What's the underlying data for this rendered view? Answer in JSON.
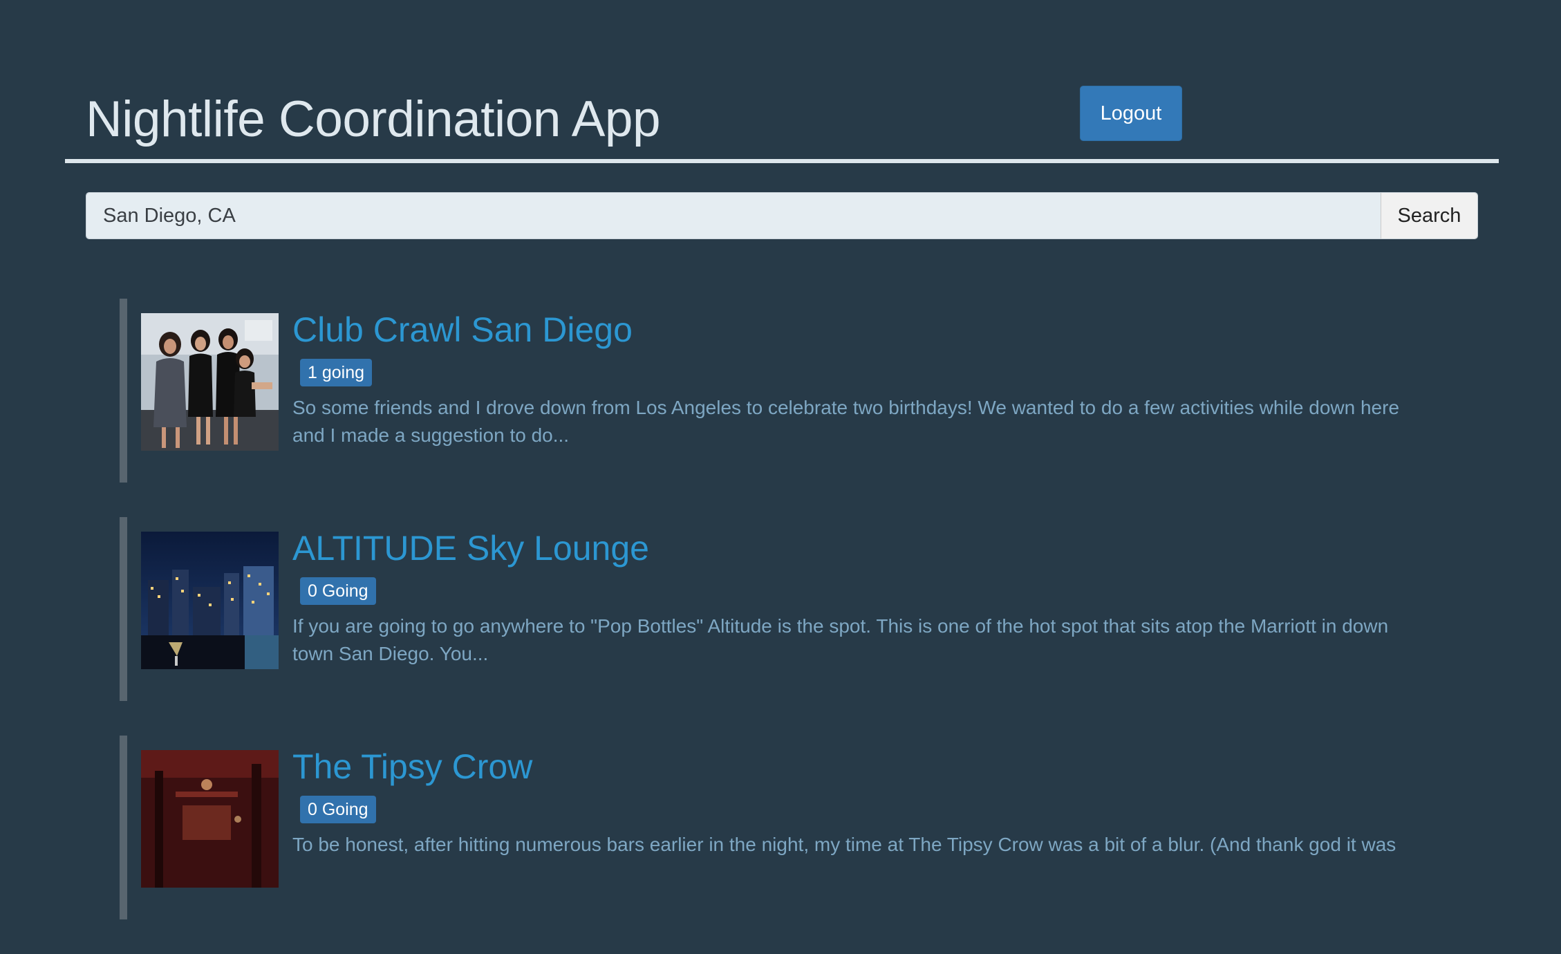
{
  "header": {
    "title": "Nightlife Coordination App",
    "logout_label": "Logout"
  },
  "search": {
    "value": "San Diego, CA",
    "button_label": "Search"
  },
  "results": [
    {
      "name": "Club Crawl San Diego",
      "going": "1 going",
      "snippet": "So some friends and I drove down from Los Angeles to celebrate two birthdays! We wanted to do a few activities while down here and I made a suggestion to do..."
    },
    {
      "name": "ALTITUDE Sky Lounge",
      "going": "0 Going",
      "snippet": "If you are going to go anywhere to \"Pop Bottles\" Altitude is the spot. This is one of the hot spot that sits atop the Marriott in down town San Diego. You..."
    },
    {
      "name": "The Tipsy Crow",
      "going": "0 Going",
      "snippet": "To be honest, after hitting numerous bars earlier in the night, my time at The Tipsy Crow was a bit of a blur. (And thank god it was"
    }
  ],
  "colors": {
    "background": "#273a48",
    "title_text": "#dfe8ee",
    "primary_button": "#3379b8",
    "link": "#2c97d2",
    "badge": "#3172ad",
    "snippet_text": "#7ea7c3",
    "result_bar": "#58656f"
  }
}
